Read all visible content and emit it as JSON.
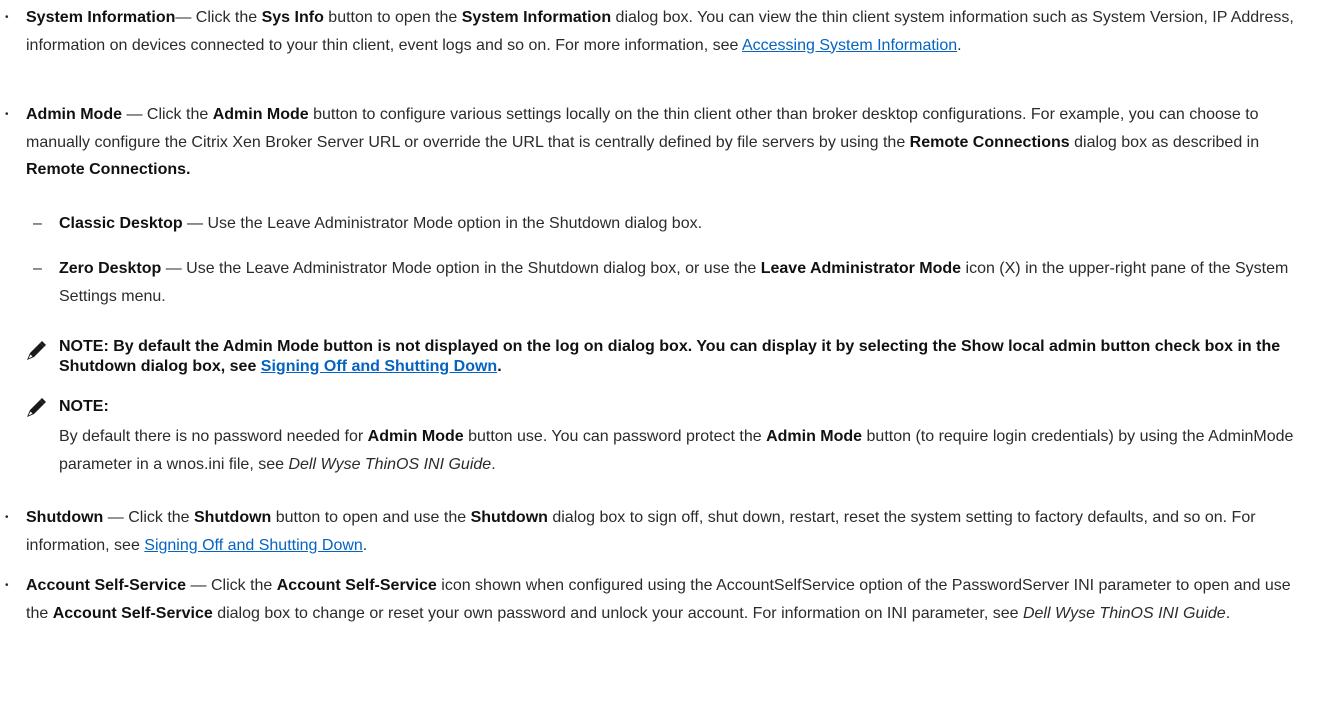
{
  "items": {
    "sysinfo": {
      "term": "System Information",
      "t1": "— Click the ",
      "b1": "Sys Info",
      "t2": " button to open the ",
      "b2": "System Information",
      "t3": " dialog box. You can view the thin client system information such as System Version, IP Address, information on devices connected to your thin client, event logs and so on. For more information, see ",
      "link": "Accessing System Information",
      "t4": "."
    },
    "admin": {
      "term": "Admin Mode",
      "t1": " — Click the ",
      "b1": "Admin Mode",
      "t2": " button to configure various settings locally on the thin client other than broker desktop configurations. For example, you can choose to manually configure the Citrix Xen Broker Server URL or override the URL that is centrally defined by file servers by using the ",
      "b2": "Remote Connections",
      "t3": " dialog box as described in ",
      "b3": "Remote Connections."
    },
    "classic": {
      "dash": "–",
      "term": "Classic Desktop",
      "text": " — Use the Leave Administrator Mode option in the Shutdown dialog box."
    },
    "zero": {
      "dash": "–",
      "term": "Zero Desktop",
      "t1": " — Use the Leave Administrator Mode option in the Shutdown dialog box, or use the ",
      "b1": "Leave Administrator Mode",
      "t2": " icon (X) in the upper-right pane of the System Settings menu."
    },
    "note1": {
      "text": "NOTE: By default the Admin Mode button is not displayed on the log on dialog box. You can display it by selecting the Show local admin button check box in the Shutdown dialog box, see ",
      "link": "Signing Off and Shutting Down",
      "end": "."
    },
    "note2": {
      "label": "NOTE:",
      "t1": "By default there is no password needed for ",
      "b1": "Admin Mode",
      "t2": " button use. You can password protect the ",
      "b2": "Admin Mode",
      "t3": " button (to require login credentials) by using the AdminMode parameter in a wnos.ini file, see ",
      "i1": "Dell Wyse ThinOS INI Guide",
      "t4": "."
    },
    "shutdown": {
      "term": "Shutdown",
      "t1": " — Click the ",
      "b1": "Shutdown",
      "t2": " button to open and use the ",
      "b2": "Shutdown",
      "t3": " dialog box to sign off, shut down, restart, reset the system setting to factory defaults, and so on. For information, see ",
      "link": "Signing Off and Shutting Down",
      "t4": "."
    },
    "account": {
      "term": "Account Self-Service",
      "t1": " — Click the ",
      "b1": "Account Self-Service",
      "t2": " icon shown when configured using the AccountSelfService option of the PasswordServer INI parameter to open and use the ",
      "b2": "Account Self-Service",
      "t3": " dialog box to change or reset your own password and unlock your account. For information on INI parameter, see ",
      "i1": "Dell Wyse ThinOS INI Guide",
      "t4": "."
    }
  },
  "bullet_glyph": "•",
  "icons": {
    "note": "pencil-note-icon"
  }
}
